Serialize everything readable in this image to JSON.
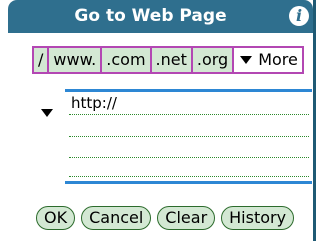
{
  "dialog": {
    "title": "Go to Web Page",
    "info_icon": "info-icon",
    "info_glyph": "i"
  },
  "shortcuts": {
    "items": [
      "/",
      "www.",
      ".com",
      ".net",
      ".org"
    ],
    "more_label": "More"
  },
  "url_field": {
    "value": "http://"
  },
  "buttons": {
    "ok": "OK",
    "cancel": "Cancel",
    "clear": "Clear",
    "history": "History"
  },
  "colors": {
    "titlebar": "#2f6f8e",
    "button_fill": "#d3e8d3",
    "shortcut_border": "#b347b3",
    "field_line": "#2d87d4",
    "dotted_line": "#2c8a2c"
  }
}
